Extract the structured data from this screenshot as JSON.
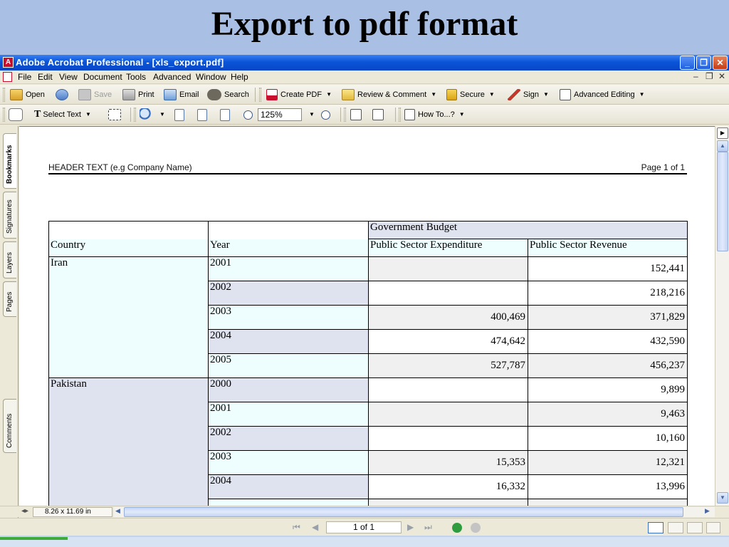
{
  "slide": {
    "title": "Export to pdf format"
  },
  "window": {
    "title": "Adobe Acrobat Professional - [xls_export.pdf]",
    "controls": {
      "minimize": "_",
      "restore": "❐",
      "close": "✕"
    }
  },
  "menu": [
    "File",
    "Edit",
    "View",
    "Document",
    "Tools",
    "Advanced",
    "Window",
    "Help"
  ],
  "mdi_controls": {
    "minimize": "–",
    "restore": "❐",
    "close": "✕"
  },
  "toolbar1": {
    "open": "Open",
    "save": "Save",
    "print": "Print",
    "email": "Email",
    "search": "Search",
    "create_pdf": "Create PDF",
    "review": "Review & Comment",
    "secure": "Secure",
    "sign": "Sign",
    "advanced_editing": "Advanced Editing"
  },
  "toolbar2": {
    "select_text": "Select Text",
    "zoom_value": "125%",
    "how_to": "How To...?"
  },
  "nav_tabs": [
    "Bookmarks",
    "Signatures",
    "Layers",
    "Pages",
    "Comments"
  ],
  "page": {
    "header_left": "HEADER TEXT (e.g Company Name)",
    "header_right": "Page 1 of 1"
  },
  "table": {
    "group_header": "Government Budget",
    "columns": [
      "Country",
      "Year",
      "Public Sector Expenditure",
      "Public Sector Revenue"
    ],
    "countries": [
      {
        "name": "Iran",
        "rows": [
          {
            "year": "2001",
            "expenditure": "",
            "revenue": "152,441"
          },
          {
            "year": "2002",
            "expenditure": "",
            "revenue": "218,216"
          },
          {
            "year": "2003",
            "expenditure": "400,469",
            "revenue": "371,829"
          },
          {
            "year": "2004",
            "expenditure": "474,642",
            "revenue": "432,590"
          },
          {
            "year": "2005",
            "expenditure": "527,787",
            "revenue": "456,237"
          }
        ]
      },
      {
        "name": "Pakistan",
        "rows": [
          {
            "year": "2000",
            "expenditure": "",
            "revenue": "9,899"
          },
          {
            "year": "2001",
            "expenditure": "",
            "revenue": "9,463"
          },
          {
            "year": "2002",
            "expenditure": "",
            "revenue": "10,160"
          },
          {
            "year": "2003",
            "expenditure": "15,353",
            "revenue": "12,321"
          },
          {
            "year": "2004",
            "expenditure": "16,332",
            "revenue": "13,996"
          }
        ]
      }
    ]
  },
  "status": {
    "page_size": "8.26 x 11.69 in"
  },
  "navigation": {
    "page_indicator": "1 of 1"
  }
}
